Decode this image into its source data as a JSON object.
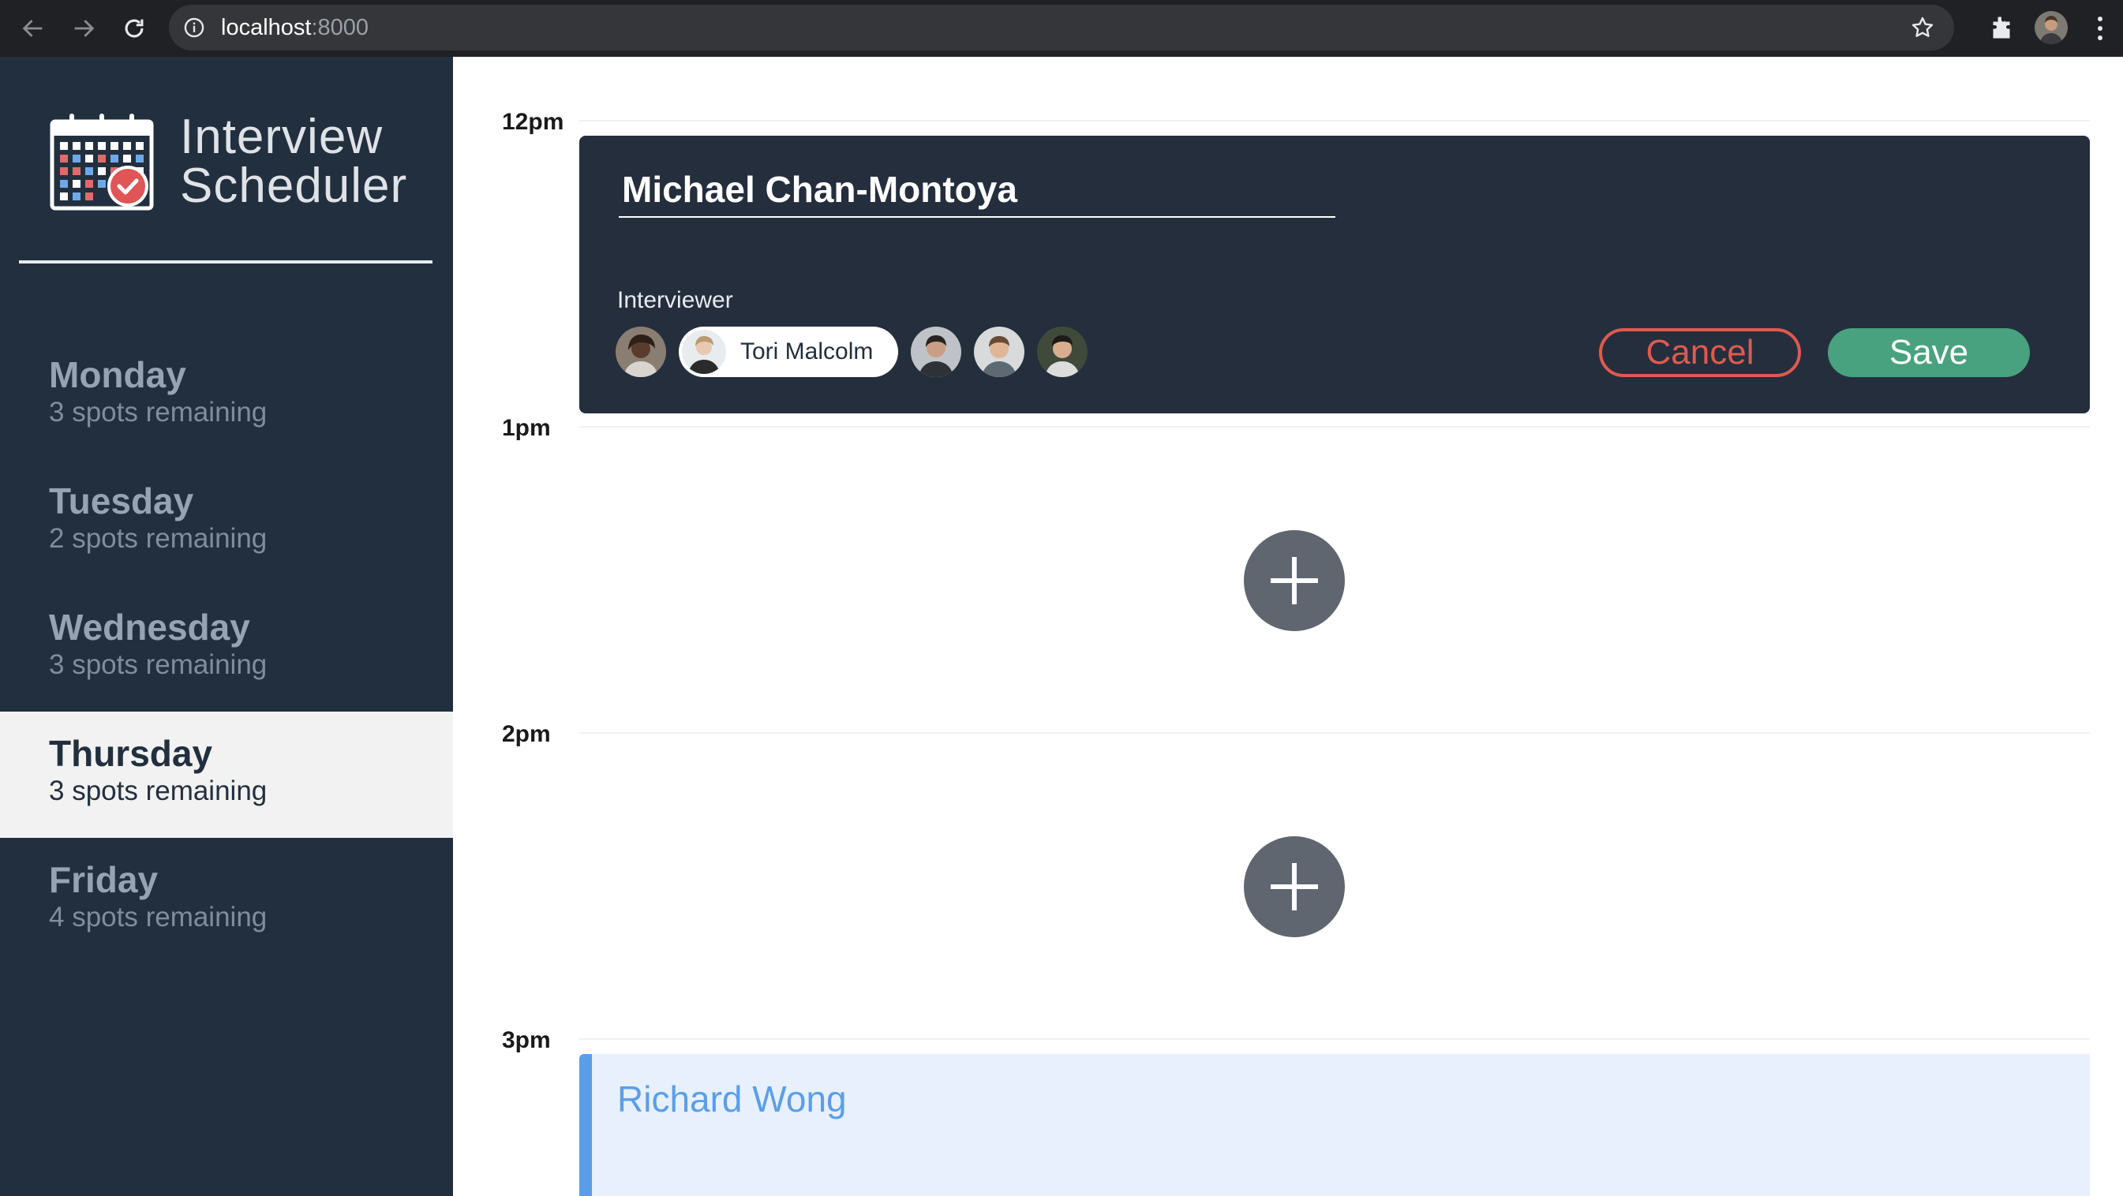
{
  "browser": {
    "url_host": "localhost",
    "url_port": ":8000"
  },
  "app": {
    "title_line1": "Interview",
    "title_line2": "Scheduler"
  },
  "sidebar": {
    "days": [
      {
        "name": "Monday",
        "spots": "3 spots remaining",
        "selected": false
      },
      {
        "name": "Tuesday",
        "spots": "2 spots remaining",
        "selected": false
      },
      {
        "name": "Wednesday",
        "spots": "3 spots remaining",
        "selected": false
      },
      {
        "name": "Thursday",
        "spots": "3 spots remaining",
        "selected": true
      },
      {
        "name": "Friday",
        "spots": "4 spots remaining",
        "selected": false
      }
    ]
  },
  "schedule": {
    "times": [
      "12pm",
      "1pm",
      "2pm",
      "3pm"
    ],
    "form": {
      "student_name": "Michael Chan-Montoya",
      "interviewer_label": "Interviewer",
      "selected_interviewer": "Tori Malcolm",
      "cancel_label": "Cancel",
      "save_label": "Save"
    },
    "booked": {
      "student": "Richard Wong"
    }
  },
  "colors": {
    "sidebar_bg": "#222f3e",
    "form_bg": "#252e3d",
    "cancel": "#e05a4e",
    "save": "#48a27f",
    "booked_accent": "#5a9eea"
  }
}
